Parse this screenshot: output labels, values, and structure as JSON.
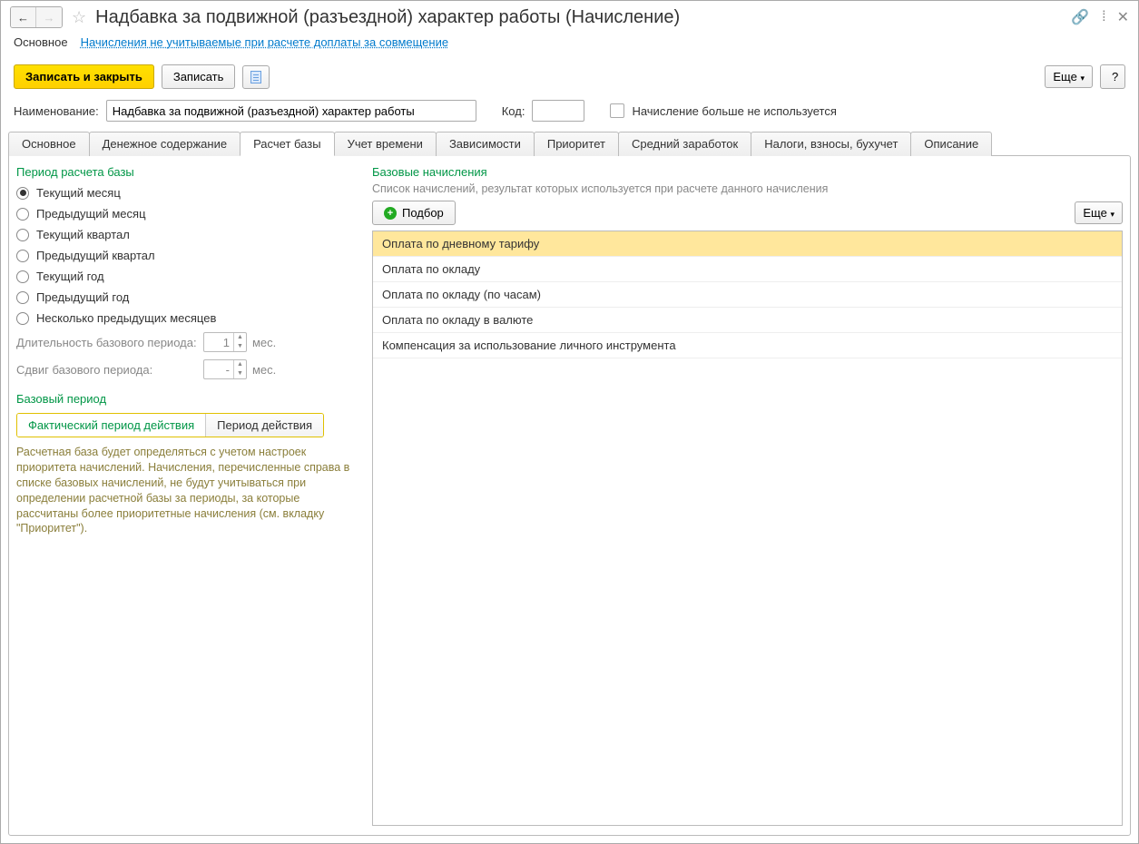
{
  "title": "Надбавка за подвижной (разъездной) характер работы (Начисление)",
  "subnav": {
    "active": "Основное",
    "link": "Начисления не учитываемые при расчете доплаты за совмещение"
  },
  "toolbar": {
    "save_close": "Записать и закрыть",
    "save": "Записать",
    "more": "Еще",
    "help": "?"
  },
  "form": {
    "name_label": "Наименование:",
    "name_value": "Надбавка за подвижной (разъездной) характер работы",
    "code_label": "Код:",
    "code_value": "",
    "disabled_label": "Начисление больше не используется"
  },
  "tabs": [
    "Основное",
    "Денежное содержание",
    "Расчет базы",
    "Учет времени",
    "Зависимости",
    "Приоритет",
    "Средний заработок",
    "Налоги, взносы, бухучет",
    "Описание"
  ],
  "active_tab_index": 2,
  "left": {
    "section1_title": "Период расчета базы",
    "radios": [
      "Текущий месяц",
      "Предыдущий месяц",
      "Текущий квартал",
      "Предыдущий квартал",
      "Текущий год",
      "Предыдущий год",
      "Несколько предыдущих месяцев"
    ],
    "radio_selected": 0,
    "duration_label": "Длительность базового периода:",
    "duration_value": "1",
    "duration_unit": "мес.",
    "shift_label": "Сдвиг базового периода:",
    "shift_value": "-",
    "shift_unit": "мес.",
    "section2_title": "Базовый период",
    "seg": [
      "Фактический период действия",
      "Период действия"
    ],
    "seg_active": 0,
    "desc": "Расчетная база будет определяться с учетом настроек приоритета начислений. Начисления, перечисленные справа в списке базовых начислений, не будут учитываться при определении расчетной базы за периоды, за которые рассчитаны более приоритетные начисления (см. вкладку \"Приоритет\")."
  },
  "right": {
    "title": "Базовые начисления",
    "hint": "Список начислений, результат которых используется при расчете данного начисления",
    "select_btn": "Подбор",
    "more": "Еще",
    "items": [
      "Оплата по дневному тарифу",
      "Оплата по окладу",
      "Оплата по окладу (по часам)",
      "Оплата по окладу в валюте",
      "Компенсация за использование личного инструмента"
    ],
    "selected_index": 0
  }
}
